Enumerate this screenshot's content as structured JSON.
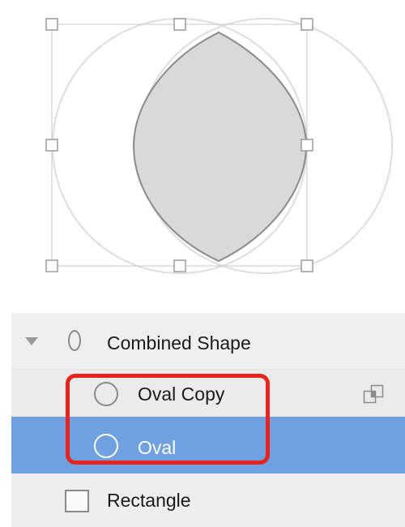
{
  "layers": [
    {
      "label": "Combined Shape",
      "icon": "combined-shape-icon",
      "expanded": true,
      "selected": false
    },
    {
      "label": "Oval Copy",
      "icon": "oval-icon",
      "boolean_operation_icon": "intersect-icon",
      "selected": false
    },
    {
      "label": "Oval",
      "icon": "oval-icon",
      "selected": true
    },
    {
      "label": "Rectangle",
      "icon": "rectangle-icon",
      "selected": false
    }
  ],
  "colors": {
    "selection": "#6fa0e0",
    "annotation": "#e8231d",
    "shape_fill": "#d9d9d9",
    "shape_stroke": "#8a8a8a"
  }
}
